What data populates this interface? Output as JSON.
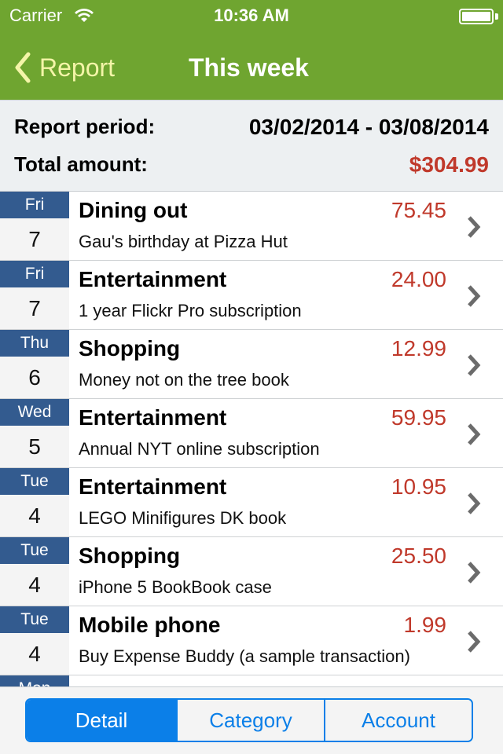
{
  "status_bar": {
    "carrier": "Carrier",
    "time": "10:36 AM",
    "wifi_icon": "wifi-icon",
    "battery_icon": "battery-icon"
  },
  "nav": {
    "back_label": "Report",
    "back_icon": "chevron-left-icon",
    "title": "This week"
  },
  "summary": {
    "period_label": "Report period:",
    "period_value": "03/02/2014 - 03/08/2014",
    "total_label": "Total amount:",
    "total_value": "$304.99"
  },
  "transactions": [
    {
      "day": "Fri",
      "date": "7",
      "category": "Dining out",
      "note": "Gau's birthday at Pizza Hut",
      "amount": "75.45"
    },
    {
      "day": "Fri",
      "date": "7",
      "category": "Entertainment",
      "note": "1 year Flickr Pro subscription",
      "amount": "24.00"
    },
    {
      "day": "Thu",
      "date": "6",
      "category": "Shopping",
      "note": "Money not on the tree book",
      "amount": "12.99"
    },
    {
      "day": "Wed",
      "date": "5",
      "category": "Entertainment",
      "note": "Annual NYT online subscription",
      "amount": "59.95"
    },
    {
      "day": "Tue",
      "date": "4",
      "category": "Entertainment",
      "note": "LEGO Minifigures DK book",
      "amount": "10.95"
    },
    {
      "day": "Tue",
      "date": "4",
      "category": "Shopping",
      "note": "iPhone 5 BookBook case",
      "amount": "25.50"
    },
    {
      "day": "Tue",
      "date": "4",
      "category": "Mobile phone",
      "note": "Buy Expense Buddy (a sample transaction)",
      "amount": "1.99"
    },
    {
      "day": "Mon",
      "date": "",
      "category": "",
      "note": "",
      "amount": ""
    }
  ],
  "segments": {
    "selected": "Detail",
    "items": [
      "Detail",
      "Category",
      "Account"
    ]
  },
  "colors": {
    "nav_green": "#6fa530",
    "back_yellow": "#f4f5a8",
    "amount_red": "#c0392b",
    "day_blue": "#335b8f",
    "segment_blue": "#0b7fe8"
  }
}
